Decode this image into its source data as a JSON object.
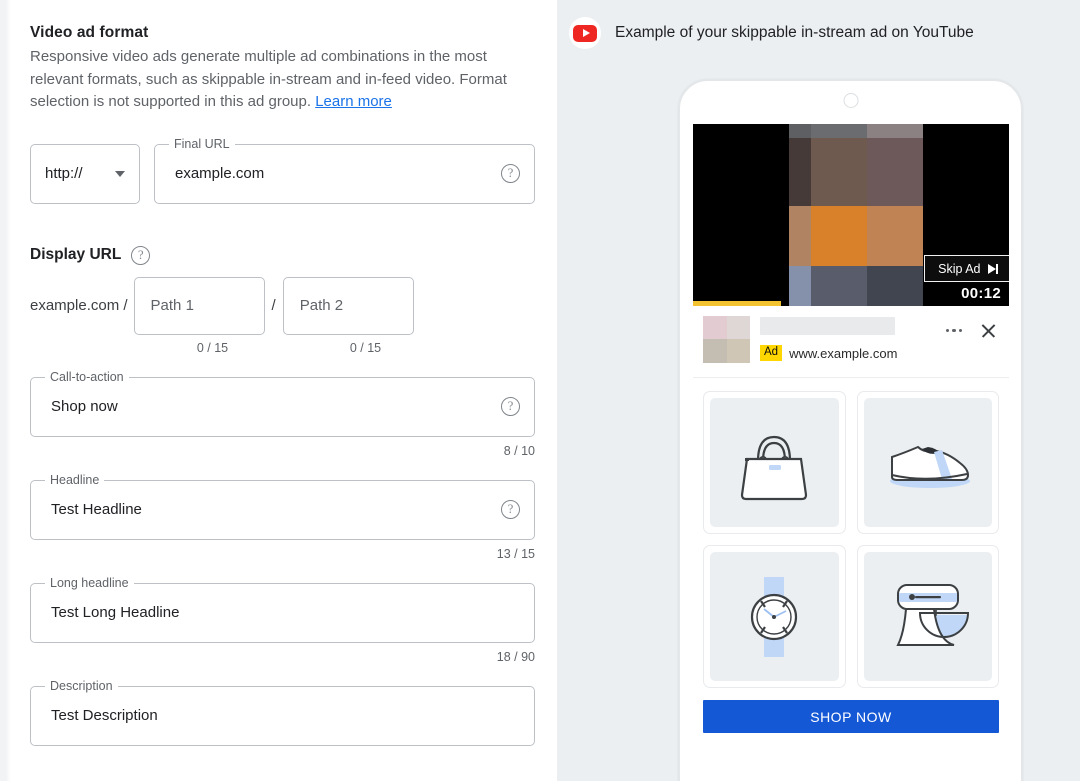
{
  "left": {
    "section_title": "Video ad format",
    "section_desc": "Responsive video ads generate multiple ad combinations in the most relevant formats, such as skippable in-stream and in-feed video. Format selection is not supported in this ad group. ",
    "learn_more": "Learn more",
    "protocol": {
      "value": "http://"
    },
    "final_url": {
      "legend": "Final URL",
      "value": "example.com"
    },
    "display_url": {
      "label": "Display URL",
      "domain": "example.com /",
      "separator": "/",
      "path1_placeholder": "Path 1",
      "path2_placeholder": "Path 2",
      "path1_counter": "0 / 15",
      "path2_counter": "0 / 15"
    },
    "fields": [
      {
        "legend": "Call-to-action",
        "value": "Shop now",
        "counter": "8 / 10",
        "has_help": true,
        "name": "call-to-action"
      },
      {
        "legend": "Headline",
        "value": "Test Headline",
        "counter": "13 / 15",
        "has_help": true,
        "name": "headline"
      },
      {
        "legend": "Long headline",
        "value": "Test Long Headline",
        "counter": "18 / 90",
        "has_help": false,
        "name": "long-headline"
      },
      {
        "legend": "Description",
        "value": "Test Description",
        "counter": "",
        "has_help": false,
        "name": "description"
      }
    ]
  },
  "preview": {
    "header_title": "Example of your skippable in-stream ad on YouTube",
    "platform_icon": "youtube-icon",
    "player": {
      "skip_label": "Skip Ad",
      "skip_icon": "skip-next-icon",
      "timer": "00:12",
      "progress_percent": 28,
      "mosaic_colors": [
        "#5e5f63",
        "#6b6c70",
        "#8b8183",
        "#453a38",
        "#6f5a50",
        "#6e595a",
        "#b08363",
        "#d9812a",
        "#bf8354",
        "#8590ab",
        "#595d6b",
        "#41454f"
      ]
    },
    "adbar": {
      "ad_badge": "Ad",
      "ad_url": "www.example.com",
      "thumb_colors": [
        "#e3ccd1",
        "#ded7d5",
        "#c4beb2",
        "#cfc6b5"
      ],
      "menu_icon": "more-options-icon",
      "close_icon": "close-icon"
    },
    "products": [
      {
        "name": "handbag",
        "icon": "handbag-icon"
      },
      {
        "name": "sneaker",
        "icon": "sneaker-icon"
      },
      {
        "name": "watch",
        "icon": "watch-icon"
      },
      {
        "name": "stand-mixer",
        "icon": "stand-mixer-icon"
      }
    ],
    "cta_button": "SHOP NOW"
  },
  "colors": {
    "accent_blue": "#1558d6",
    "link_blue": "#1a73e8",
    "youtube_red": "#ee2722",
    "ad_yellow": "#ffd600",
    "progress_yellow": "#f2c230"
  }
}
